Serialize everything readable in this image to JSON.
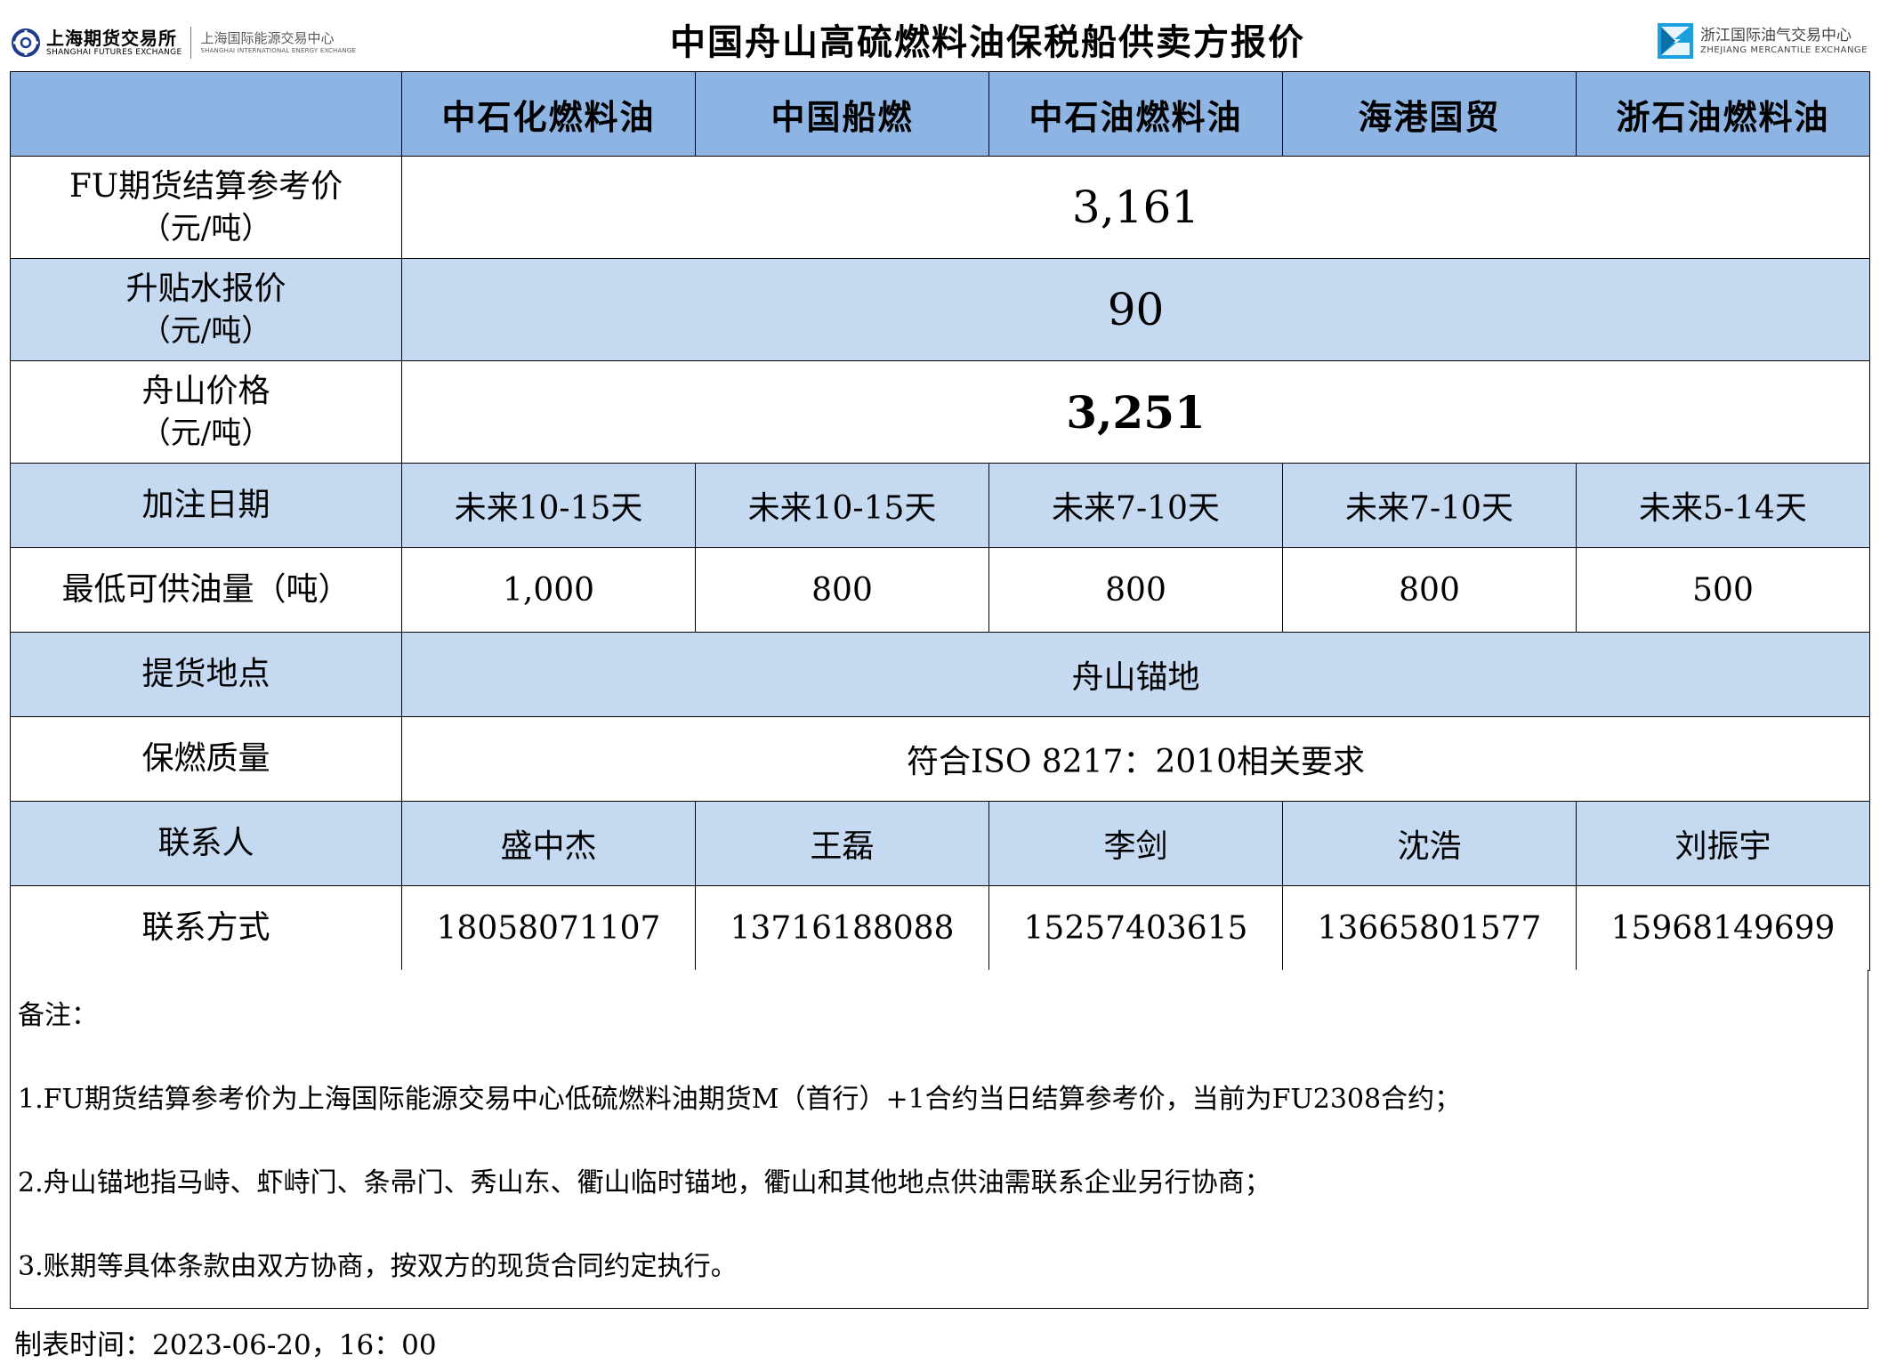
{
  "header": {
    "title": "中国舟山高硫燃料油保税船供卖方报价",
    "left_logo": {
      "name_cn": "上海期货交易所",
      "name_en": "SHANGHAI FUTURES EXCHANGE",
      "sub_cn": "上海国际能源交易中心",
      "sub_en": "SHANGHAI INTERNATIONAL ENERGY EXCHANGE"
    },
    "right_logo": {
      "name_cn": "浙江国际油气交易中心",
      "name_en": "ZHEJIANG MERCANTILE EXCHANGE"
    }
  },
  "table": {
    "suppliers": [
      "中石化燃料油",
      "中国船燃",
      "中石油燃料油",
      "海港国贸",
      "浙石油燃料油"
    ],
    "fu_price": {
      "label": "FU期货结算参考价",
      "unit": "（元/吨）",
      "value": "3,161"
    },
    "premium": {
      "label": "升贴水报价",
      "unit": "（元/吨）",
      "value": "90"
    },
    "zhoushan_price": {
      "label": "舟山价格",
      "unit": "（元/吨）",
      "value": "3,251"
    },
    "delivery_date": {
      "label": "加注日期",
      "values": [
        "未来10-15天",
        "未来10-15天",
        "未来7-10天",
        "未来7-10天",
        "未来5-14天"
      ]
    },
    "min_quantity": {
      "label": "最低可供油量（吨）",
      "values": [
        "1,000",
        "800",
        "800",
        "800",
        "500"
      ]
    },
    "pickup_location": {
      "label": "提货地点",
      "value": "舟山锚地"
    },
    "quality": {
      "label": "保燃质量",
      "value": "符合ISO 8217：2010相关要求"
    },
    "contact_person": {
      "label": "联系人",
      "values": [
        "盛中杰",
        "王磊",
        "李剑",
        "沈浩",
        "刘振宇"
      ]
    },
    "contact_phone": {
      "label": "联系方式",
      "values": [
        "18058071107",
        "13716188088",
        "15257403615",
        "13665801577",
        "15968149699"
      ]
    }
  },
  "notes": {
    "title": "备注：",
    "items": [
      "1.FU期货结算参考价为上海国际能源交易中心低硫燃料油期货M（首行）+1合约当日结算参考价，当前为FU2308合约；",
      "2.舟山锚地指马峙、虾峙门、条帚门、秀山东、衢山临时锚地，衢山和其他地点供油需联系企业另行协商；",
      "3.账期等具体条款由双方协商，按双方的现货合同约定执行。"
    ]
  },
  "footer": {
    "made_time": "制表时间：2023-06-20，16：00"
  },
  "colors": {
    "header_blue": "#8db4e2",
    "row_blue": "#c5d9f1",
    "row_white": "#ffffff",
    "sfe_logo_blue": "#1f3a8a",
    "zme_logo_blue": "#1aa0dc"
  }
}
